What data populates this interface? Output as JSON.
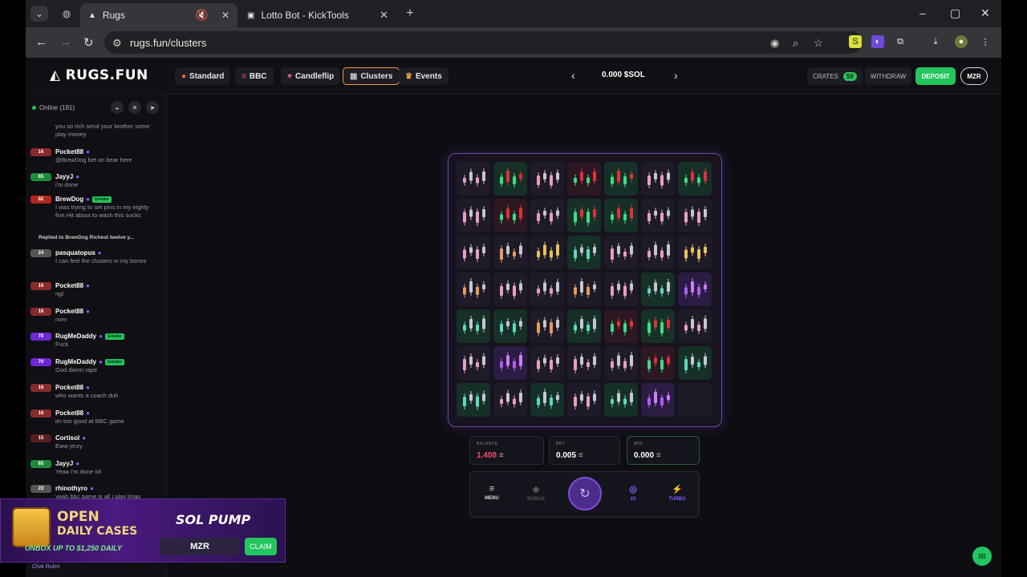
{
  "browser": {
    "tabs": [
      {
        "title": "Rugs",
        "active": true
      },
      {
        "title": "Lotto Bot - KickTools",
        "active": false
      }
    ],
    "url": "rugs.fun/clusters",
    "new_tab": "+",
    "window_controls": {
      "minimize": "–",
      "maximize": "▢",
      "close": "✕"
    }
  },
  "header": {
    "logo": "RUGS.FUN",
    "nav": [
      {
        "label": "Standard",
        "icon": "flame-icon",
        "glyph": "🔥",
        "selected": false
      },
      {
        "label": "BBC",
        "icon": "list-icon",
        "glyph": "≡",
        "selected": false
      },
      {
        "label": "Candleflip",
        "icon": "candle-icon",
        "glyph": "♥",
        "selected": false
      },
      {
        "label": "Clusters",
        "icon": "grid-icon",
        "glyph": "▦",
        "selected": true
      },
      {
        "label": "Events",
        "icon": "trophy-icon",
        "glyph": "🏆",
        "selected": false
      }
    ],
    "center_balance": "0.000 $SOL",
    "crates_label": "CRATES",
    "crates_count": "59",
    "withdraw_label": "WITHDRAW",
    "deposit_label": "DEPOSIT",
    "user_label": "MZR"
  },
  "chat": {
    "online": "Online (191)",
    "messages": [
      {
        "level": "",
        "user": "",
        "text": "you so rich send your brother some play money",
        "color": "#444"
      },
      {
        "level": "16",
        "user": "Pocket88",
        "text": "@BrewDog bet on bear here",
        "color": "#8a2b2b"
      },
      {
        "level": "65",
        "user": "JayyJ",
        "text": "i'm done",
        "color": "#1f8b3a"
      },
      {
        "level": "82",
        "user": "BrewDog",
        "badge": "Grinder",
        "text": "I was trying to set pins in my eighty five.Hit about to wash this sucks",
        "color": "#b3261e"
      },
      {
        "level": "",
        "user": "Replied to BrewDog Richest twelve y...",
        "text": "",
        "color": ""
      },
      {
        "level": "24",
        "user": "pasquatopus",
        "text": "I can feel the clusters in my bones",
        "color": "#555"
      },
      {
        "level": "16",
        "user": "Pocket88",
        "text": "ngl",
        "color": "#8a2b2b"
      },
      {
        "level": "16",
        "user": "Pocket88",
        "text": "nvm",
        "color": "#8a2b2b"
      },
      {
        "level": "70",
        "user": "RugMeDaddy",
        "badge": "Grinder",
        "text": "Fuck",
        "color": "#6d28d9"
      },
      {
        "level": "70",
        "user": "RugMeDaddy",
        "badge": "Grinder",
        "text": "God damn rape",
        "color": "#6d28d9"
      },
      {
        "level": "16",
        "user": "Pocket88",
        "text": "who wants a coach duh",
        "color": "#8a2b2b"
      },
      {
        "level": "16",
        "user": "Pocket88",
        "text": "im too good at BBC game",
        "color": "#8a2b2b"
      },
      {
        "level": "15",
        "user": "Cortisol",
        "text": "Eww jerzy",
        "color": "#5a1d1d"
      },
      {
        "level": "65",
        "user": "JayyJ",
        "text": "Yeaa I'm done lol",
        "color": "#1f8b3a"
      },
      {
        "level": "23",
        "user": "rhinothyro",
        "text": "yeah bbc game is all i play lmao",
        "color": "#555"
      }
    ],
    "footer": "Chat Rules"
  },
  "game": {
    "balance_label": "BALANCE",
    "balance_value": "1.408",
    "bet_label": "BET",
    "bet_value": "0.005",
    "win_label": "WIN",
    "win_value": "0.000",
    "controls": [
      {
        "label": "MENU",
        "icon": "menu-icon"
      },
      {
        "label": "BONUS",
        "icon": "gem-icon"
      },
      {
        "label": "23",
        "icon": "auto-icon"
      },
      {
        "label": "TURBO",
        "icon": "bolt-icon"
      }
    ],
    "grid_rows": [
      [
        "neutral",
        "green",
        "neutral",
        "red",
        "green",
        "neutral",
        "green"
      ],
      [
        "neutral",
        "red",
        "neutral",
        "green",
        "green",
        "neutral",
        "neutral"
      ],
      [
        "neutral",
        "orange",
        "yellow",
        "teal",
        "neutral",
        "neutral",
        "yellow"
      ],
      [
        "orange",
        "neutral",
        "neutral",
        "orange",
        "neutral",
        "teal",
        "purple"
      ],
      [
        "teal",
        "teal",
        "orange",
        "teal",
        "red",
        "green",
        "neutral"
      ],
      [
        "neutral",
        "purple",
        "neutral",
        "neutral",
        "neutral",
        "red",
        "teal"
      ],
      [
        "teal",
        "neutral",
        "teal",
        "neutral",
        "teal",
        "purple",
        "empty"
      ]
    ]
  },
  "promo": {
    "line1": "OPEN",
    "line2": "DAILY CASES",
    "line3": "UNBOX UP TO $1,250 DAILY",
    "brand": "SOL PUMP",
    "code": "MZR",
    "claim": "CLAIM"
  },
  "colors": {
    "accent_green": "#22c55e",
    "accent_purple": "#8b5cf6",
    "balance_red": "#f0506e"
  }
}
